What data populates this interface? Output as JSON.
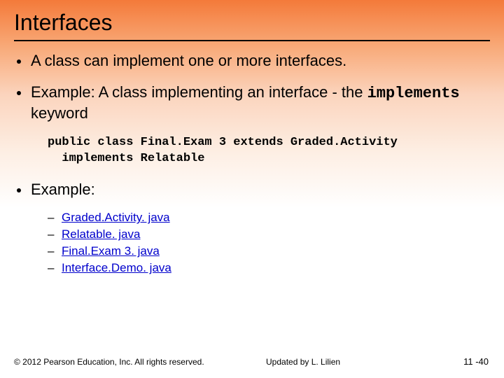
{
  "title": "Interfaces",
  "bullets": {
    "b1": "A class can implement one or more interfaces.",
    "b2_pre": "Example:   A class implementing an interface - the ",
    "b2_kw": "implements",
    "b2_post": " keyword",
    "b3": "Example:"
  },
  "code": "public class Final.Exam 3 extends Graded.Activity\n  implements Relatable",
  "links": [
    "Graded.Activity. java",
    "Relatable. java",
    "Final.Exam 3. java",
    "Interface.Demo. java"
  ],
  "footer": {
    "copyright": "© 2012 Pearson Education, Inc. All rights reserved.",
    "updated": "Updated by L. Lilien",
    "page": "11 -40"
  }
}
